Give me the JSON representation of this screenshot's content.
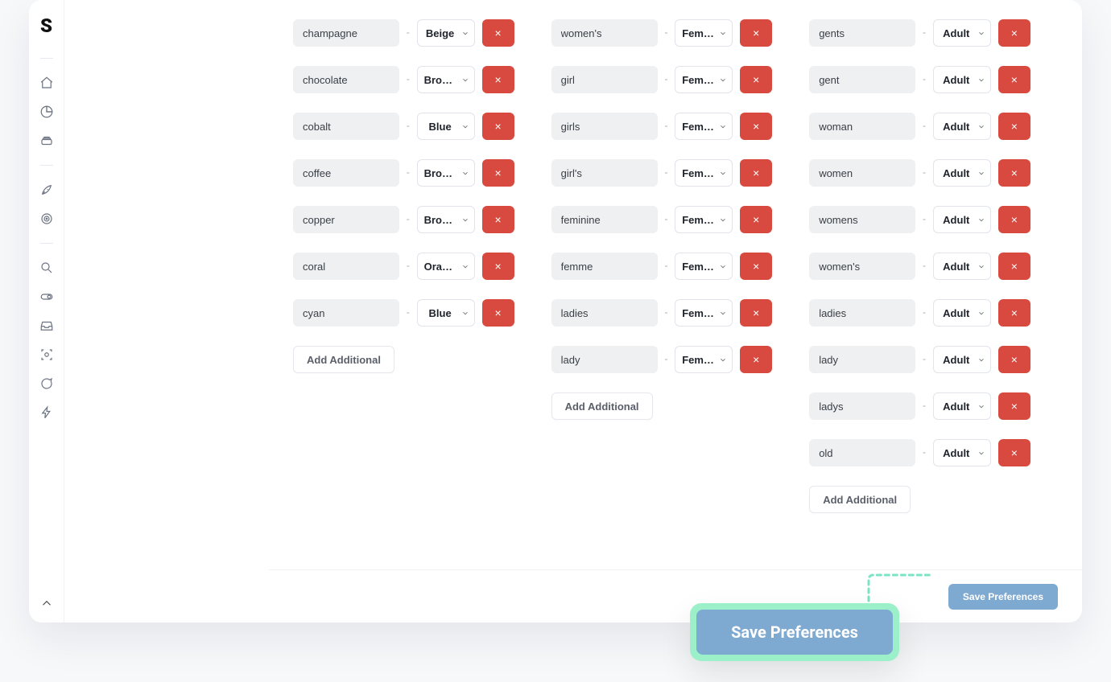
{
  "brand": "S",
  "addAdditionalLabel": "Add Additional",
  "savePreferencesLabel": "Save Preferences",
  "calloutSaveLabel": "Save Preferences",
  "columns": [
    {
      "id": "colors",
      "rows": [
        {
          "term": "champagne",
          "value": "Beige"
        },
        {
          "term": "chocolate",
          "value": "Brown"
        },
        {
          "term": "cobalt",
          "value": "Blue"
        },
        {
          "term": "coffee",
          "value": "Brown"
        },
        {
          "term": "copper",
          "value": "Brown"
        },
        {
          "term": "coral",
          "value": "Orange"
        },
        {
          "term": "cyan",
          "value": "Blue"
        }
      ]
    },
    {
      "id": "gender",
      "rows": [
        {
          "term": "women's",
          "value": "Female"
        },
        {
          "term": "girl",
          "value": "Female"
        },
        {
          "term": "girls",
          "value": "Female"
        },
        {
          "term": "girl's",
          "value": "Female"
        },
        {
          "term": "feminine",
          "value": "Female"
        },
        {
          "term": "femme",
          "value": "Female"
        },
        {
          "term": "ladies",
          "value": "Female"
        },
        {
          "term": "lady",
          "value": "Female"
        }
      ]
    },
    {
      "id": "age",
      "rows": [
        {
          "term": "gents",
          "value": "Adult"
        },
        {
          "term": "gent",
          "value": "Adult"
        },
        {
          "term": "woman",
          "value": "Adult"
        },
        {
          "term": "women",
          "value": "Adult"
        },
        {
          "term": "womens",
          "value": "Adult"
        },
        {
          "term": "women's",
          "value": "Adult"
        },
        {
          "term": "ladies",
          "value": "Adult"
        },
        {
          "term": "lady",
          "value": "Adult"
        },
        {
          "term": "ladys",
          "value": "Adult"
        },
        {
          "term": "old",
          "value": "Adult"
        }
      ]
    }
  ]
}
